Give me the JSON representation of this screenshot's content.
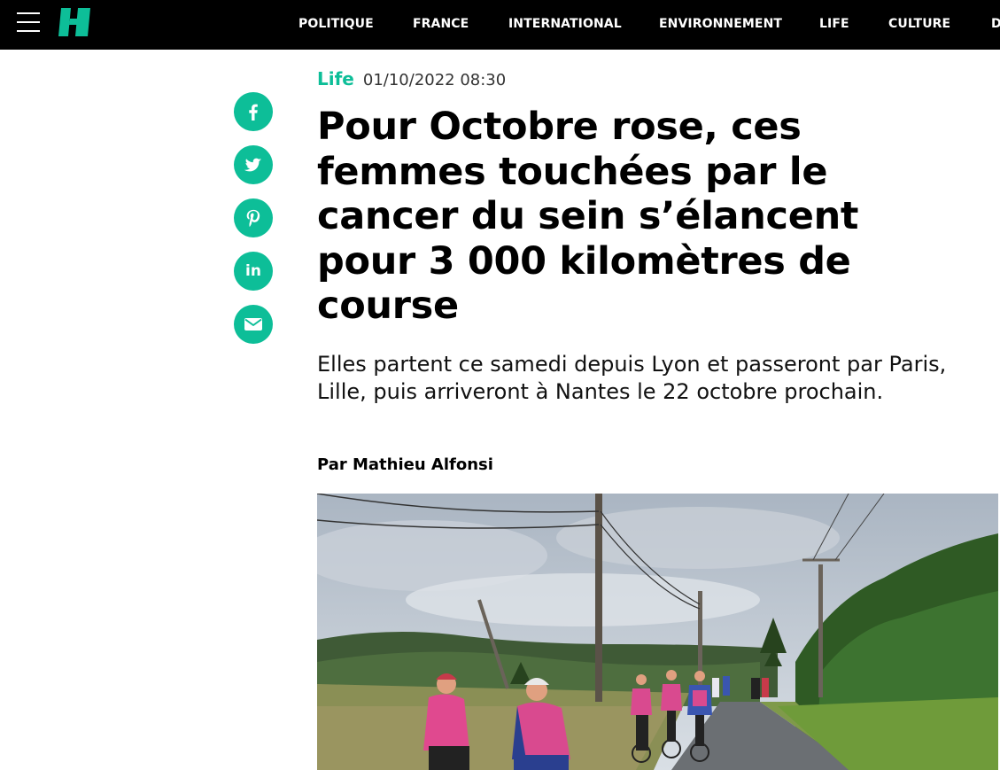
{
  "header": {
    "menu_icon": "hamburger-menu-icon",
    "logo_icon": "huffpost-logo-icon",
    "nav": [
      {
        "label": "POLITIQUE"
      },
      {
        "label": "FRANCE"
      },
      {
        "label": "INTERNATIONAL"
      },
      {
        "label": "ENVIRONNEMENT"
      },
      {
        "label": "LIFE"
      },
      {
        "label": "CULTURE"
      },
      {
        "label": "D"
      }
    ],
    "background_color": "#000000"
  },
  "share": {
    "accent_color": "#0dbe98",
    "buttons": [
      {
        "icon": "facebook-icon"
      },
      {
        "icon": "twitter-icon"
      },
      {
        "icon": "pinterest-icon"
      },
      {
        "icon": "linkedin-icon",
        "label": "in"
      },
      {
        "icon": "mail-icon"
      }
    ]
  },
  "article": {
    "category": "Life",
    "date": "01/10/2022 08:30",
    "title": "Pour Octobre rose, ces femmes touchées par le cancer du sein s’élancent pour 3 000 kilomètres de course",
    "lede": "Elles partent ce samedi depuis Lyon et passeront par Paris, Lille, puis arriveront à Nantes le 22 octobre prochain.",
    "byline": "Par Mathieu Alfonsi"
  }
}
